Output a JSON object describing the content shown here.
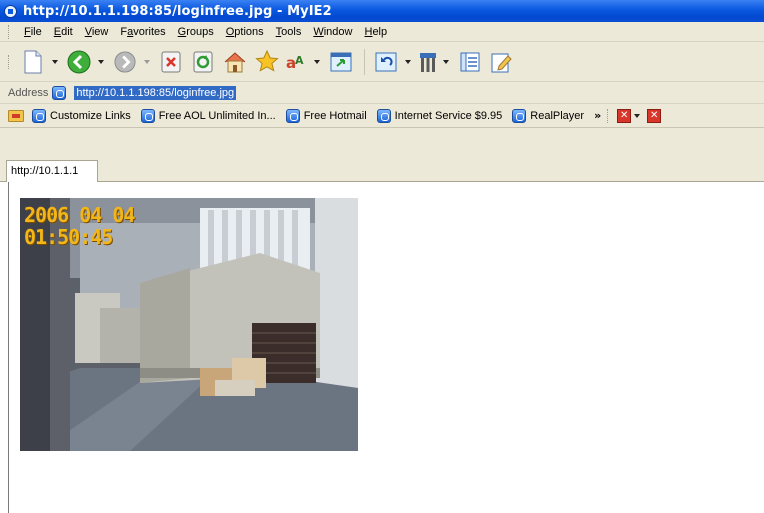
{
  "window": {
    "title": "http://10.1.1.198:85/loginfree.jpg - MyIE2"
  },
  "menu": [
    {
      "pre": "",
      "u": "F",
      "post": "ile"
    },
    {
      "pre": "",
      "u": "E",
      "post": "dit"
    },
    {
      "pre": "",
      "u": "V",
      "post": "iew"
    },
    {
      "pre": "F",
      "u": "a",
      "post": "vorites"
    },
    {
      "pre": "",
      "u": "G",
      "post": "roups"
    },
    {
      "pre": "",
      "u": "O",
      "post": "ptions"
    },
    {
      "pre": "",
      "u": "T",
      "post": "ools"
    },
    {
      "pre": "",
      "u": "W",
      "post": "indow"
    },
    {
      "pre": "",
      "u": "H",
      "post": "elp"
    }
  ],
  "toolbar": {
    "icons": [
      "new-page-icon",
      "back-icon",
      "forward-icon",
      "stop-icon",
      "refresh-icon",
      "home-icon",
      "favorites-star-icon",
      "font-size-icon",
      "fullscreen-icon",
      "undo-close-icon",
      "tools-icon",
      "list-icon",
      "edit-icon"
    ]
  },
  "address": {
    "label": "Address",
    "value": "http://10.1.1.198:85/loginfree.jpg"
  },
  "links": [
    {
      "label": "Customize Links"
    },
    {
      "label": "Free AOL Unlimited In..."
    },
    {
      "label": "Free Hotmail"
    },
    {
      "label": "Internet Service $9.95"
    },
    {
      "label": "RealPlayer"
    }
  ],
  "links_more": "»",
  "tab": {
    "label": "http://10.1.1.1"
  },
  "camera": {
    "timestamp_date": "2006 04 04",
    "timestamp_time": "01:50:45"
  },
  "colors": {
    "titlebar": "#0a58e0",
    "chrome": "#ece9d8",
    "selection": "#316ac5",
    "timestamp": "#f2b619"
  }
}
